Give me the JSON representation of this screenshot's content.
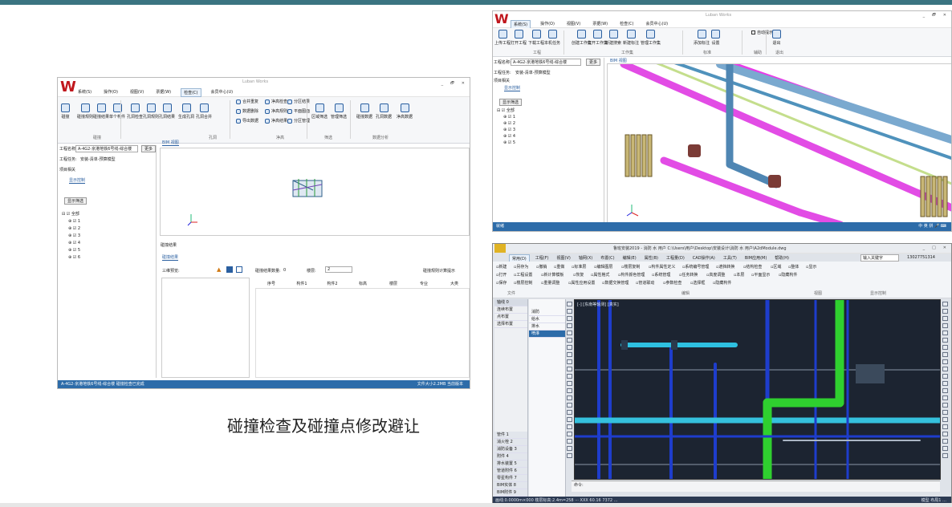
{
  "caption": "碰撞检查及碰撞点修改避让",
  "left_window": {
    "app_title": "Luban Works",
    "logo": "W",
    "menu": [
      "系统(S)",
      "操作(O)",
      "视图(V)",
      "票据(W)",
      "检查(C)",
      "会员中心(U)"
    ],
    "active_menu": "检查(C)",
    "window_controls": [
      "_",
      "🗗",
      "✕"
    ],
    "ribbon_buttons": [
      "碰撞",
      "碰撞规则",
      "碰撞结果",
      "单个构件",
      "孔洞检查",
      "孔洞规则",
      "孔洞结果",
      "生成孔洞",
      "孔洞合并",
      "合并重复",
      "数据删除",
      "导出数据",
      "净高检查",
      "净高规则",
      "净高结果",
      "分区结果",
      "平面图面",
      "分区管理",
      "区域筛选",
      "管理筛选",
      "碰撞数据",
      "孔洞数据",
      "净高数据"
    ],
    "ribbon_groups": [
      "碰撞",
      "孔洞",
      "净高",
      "筛选",
      "数据分析"
    ],
    "project_label": "工程名称:",
    "project_value": "A-4G2-京港地铁6号线-综合楼",
    "switch_btn": "更多",
    "task_label": "工程任务:",
    "task_value": "安装-清单-预算模型",
    "item_label": "项目相关",
    "panel_tab": "显示控制",
    "view_tab": "BIM 视图",
    "tree_btn": "显示筛选",
    "tree": [
      "全部",
      "1",
      "2",
      "3",
      "4",
      "5",
      "6"
    ],
    "results_tab": "碰撞结果",
    "results_sub": "碰撞结果",
    "results_label": "三维预览:",
    "count_label": "碰撞结果数量:",
    "count_value": "0",
    "level_label": "楼层:",
    "level_value": "2",
    "check_label": "碰撞规则计算提示",
    "col_headers": [
      "序号",
      "构件1",
      "构件2",
      "标高",
      "楼层",
      "专业",
      "大类"
    ],
    "status": "A-4G2-京港地铁6号线-综合楼 碰撞检查已完成",
    "status_right": "文件大小2.2MB  当前版本"
  },
  "top_window": {
    "app_title": "Luban Works",
    "logo": "W",
    "menu": [
      "系统(S)",
      "操作(O)",
      "视图(V)",
      "票据(W)",
      "检查(C)",
      "会员中心(U)"
    ],
    "active_menu": "系统(S)",
    "window_controls": [
      "_",
      "🗗",
      "✕"
    ],
    "ribbon_buttons": [
      "上传工程",
      "打开工程",
      "下载工程",
      "本机任务",
      "创建工作集",
      "打开工作集",
      "新建搜索",
      "新建标注",
      "管理工作集",
      "添加标注",
      "设置",
      "自动提示",
      "退出"
    ],
    "ribbon_groups": [
      "工程",
      "工作集",
      "标准",
      "辅助",
      "退出"
    ],
    "project_label": "工程名称:",
    "project_value": "A-4G2-京港地铁6号线-综合楼",
    "switch_btn": "更多",
    "task_label": "工程任务:",
    "task_value": "安装-清单-预算模型",
    "item_label": "项目相关",
    "panel_tab": "显示控制",
    "view_tab": "BIM 视图",
    "tree_btn": "显示筛选",
    "tree": [
      "全部",
      "1",
      "2",
      "3",
      "4",
      "5"
    ],
    "status": "就绪",
    "status_right": "中 英 拼 🎤 ⌨"
  },
  "cad_window": {
    "title": "鲁班安装2019 - 消防 水 用户  C:\\Users\\用户\\Desktop\\安装设计\\消防 水 用户\\A2dModule.dwg",
    "window_controls": [
      "_",
      "□",
      "✕"
    ],
    "menu": [
      "常用(D)",
      "工程(F)",
      "视图(V)",
      "轴网(X)",
      "布置(C)",
      "编辑(E)",
      "属性(B)",
      "工程量(D)",
      "CAD操作(A)",
      "工具(T)",
      "BIM应用(M)",
      "帮助(H)"
    ],
    "search_hint": "输入关键字",
    "user": "13027751314",
    "ribbon_groups": [
      "文件",
      "编辑",
      "视图",
      "显示控制"
    ],
    "ribbon_row1": [
      "新建",
      "另存为",
      "撤销",
      "重做",
      "标准层",
      "编辑图层",
      "楼层复制",
      "构件属性定义",
      "系统编号管理",
      "遮挡转换",
      "结构检查",
      "区域",
      "整体",
      "显示"
    ],
    "ribbon_row2": [
      "打开",
      "工程设置",
      "新计算模板",
      "恢复",
      "属性格式",
      "构件颜色管理",
      "系统管理",
      "任务转换",
      "高度调整",
      "本层",
      "平面显示",
      "隐藏构件"
    ],
    "ribbon_row3": [
      "保存",
      "楼层控制",
      "重量调整",
      "属性应用设置",
      "数据交换管理",
      "管道联动",
      "参数检查",
      "选择框",
      "隐藏构件"
    ],
    "left_panel_header": "轴线 0",
    "left_panel_items": [
      "消防",
      "给水",
      "排水",
      "喷淋"
    ],
    "left_panel_tools": [
      "连续布置",
      "点布置",
      "选择布置"
    ],
    "bottom_left": [
      "管件 1",
      "消火栓 2",
      "消防设备 3",
      "附件 4",
      "排水装置 5",
      "管道附件 6",
      "零星构件 7",
      "BIM实体 8",
      "BIM附件 9"
    ],
    "viewport_label": "[-] [东南等轴测] [真实]",
    "cmd_text": "命令:",
    "status": "画线:0.0000m×000 楼层标高:2.4m=258 ··· XXX 60.16  7372  …",
    "status_right": "模型 布局1 …"
  }
}
